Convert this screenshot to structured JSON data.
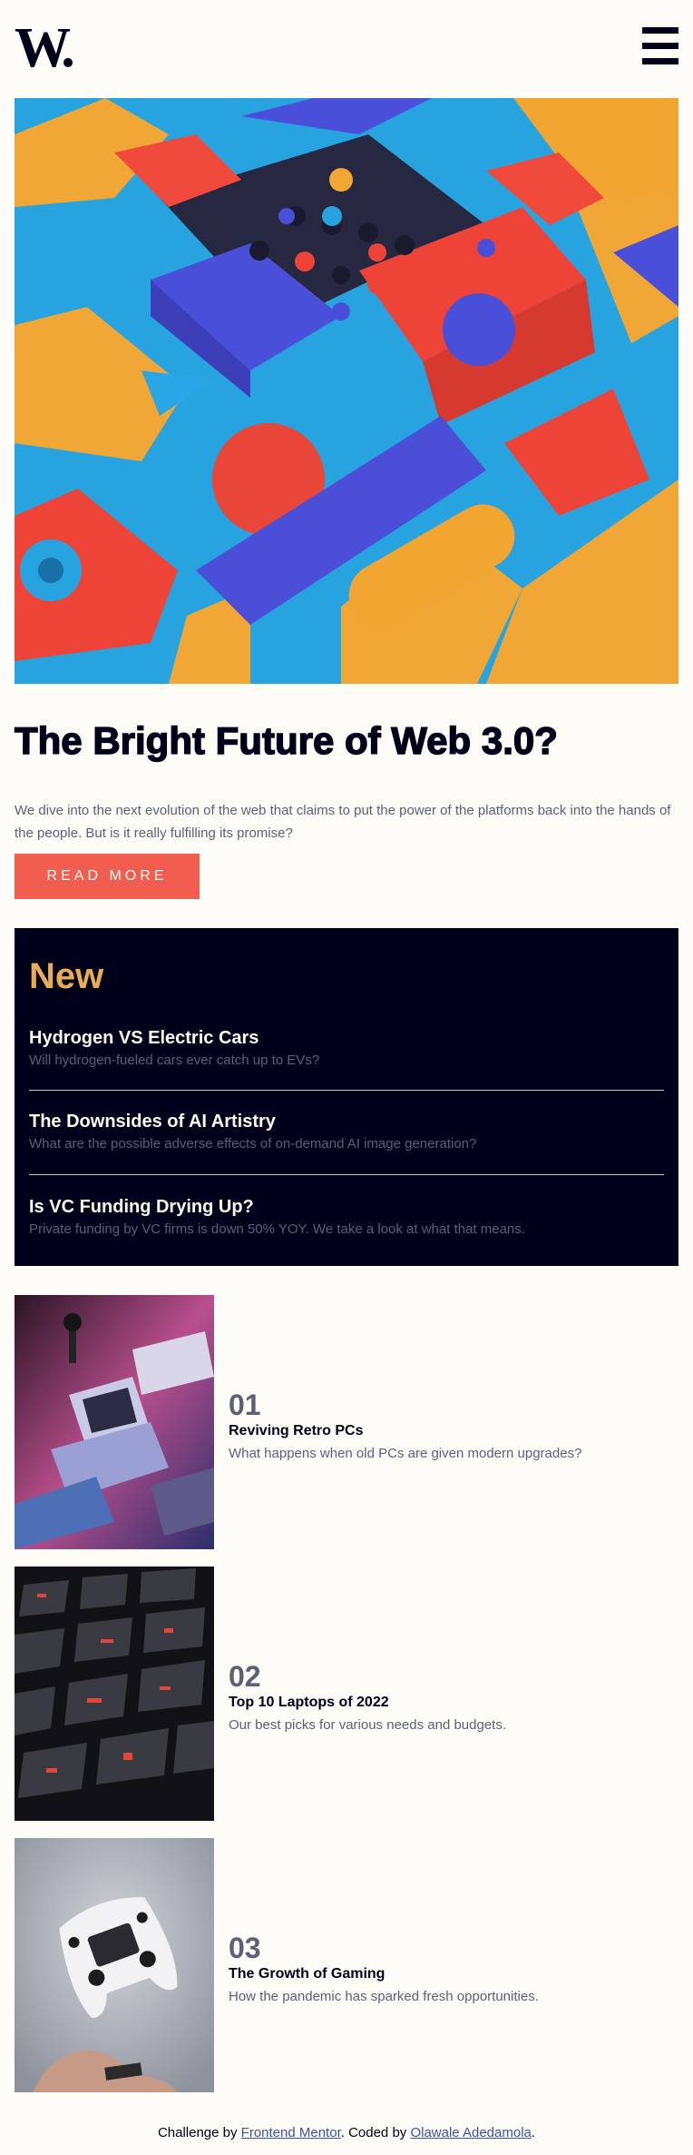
{
  "header": {
    "logo": "W.",
    "menu_icon": "hamburger-icon"
  },
  "hero": {
    "title": "The Bright Future of Web 3.0?",
    "text": "We dive into the next evolution of the web that claims to put the power of the platforms back into the hands of the people. But is it really fulfilling its promise?",
    "button": "READ MORE"
  },
  "new": {
    "title": "New",
    "items": [
      {
        "title": "Hydrogen VS Electric Cars",
        "text": "Will hydrogen-fueled cars ever catch up to EVs?"
      },
      {
        "title": "The Downsides of AI Artistry",
        "text": "What are the possible adverse effects of on-demand AI image generation?"
      },
      {
        "title": "Is VC Funding Drying Up?",
        "text": "Private funding by VC firms is down 50% YOY. We take a look at what that means."
      }
    ]
  },
  "articles": [
    {
      "num": "01",
      "title": "Reviving Retro PCs",
      "text": "What happens when old PCs are given modern upgrades?"
    },
    {
      "num": "02",
      "title": "Top 10 Laptops of 2022",
      "text": "Our best picks for various needs and budgets."
    },
    {
      "num": "03",
      "title": "The Growth of Gaming",
      "text": "How the pandemic has sparked fresh opportunities."
    }
  ],
  "footer": {
    "prefix": "Challenge by",
    "link1": "Frontend Mentor",
    "middle": ". Coded by",
    "link2": "Olawale Adedamola",
    "suffix": "."
  },
  "colors": {
    "accent": "#f15e50",
    "highlight": "#e9ab53",
    "dark": "#00001a",
    "muted": "#5d5f79",
    "background": "#fdfcf7"
  }
}
